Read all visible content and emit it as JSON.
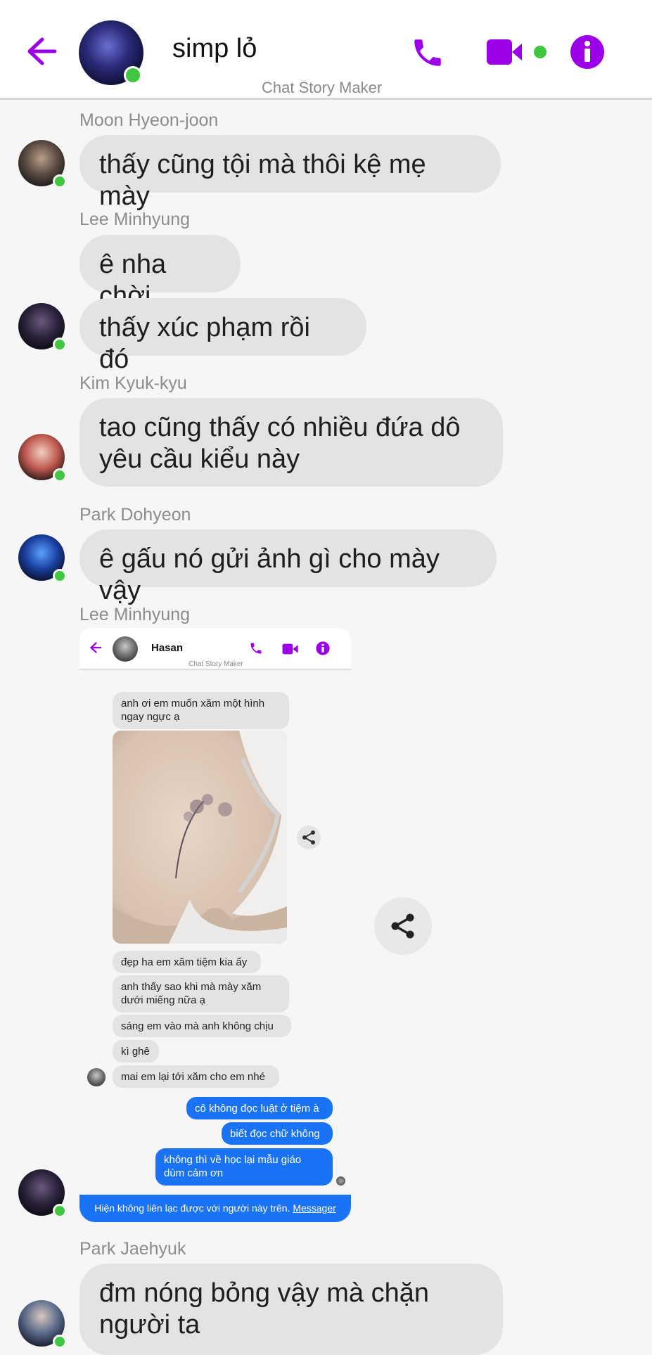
{
  "header": {
    "contact_name": "simp lỏ",
    "subtitle": "Chat Story Maker",
    "icons": [
      "back-arrow-icon",
      "phone-icon",
      "video-icon",
      "info-icon"
    ],
    "accent_color": "#9b00e8"
  },
  "messages": [
    {
      "sender": "Moon Hyeon-joon",
      "texts": [
        "thấy cũng tội mà thôi kệ mẹ mày"
      ]
    },
    {
      "sender": "Lee Minhyung",
      "texts": [
        "ê nha chời",
        "thấy xúc phạm rồi đó"
      ]
    },
    {
      "sender": "Kim Kyuk-kyu",
      "texts": [
        "tao cũng thấy có nhiều đứa dô\nyêu cầu kiểu này"
      ]
    },
    {
      "sender": "Park Dohyeon",
      "texts": [
        "ê gấu nó gửi ảnh gì cho mày vậy"
      ]
    },
    {
      "sender": "Lee Minhyung",
      "texts": []
    },
    {
      "sender": "Park Jaehyuk",
      "texts": [
        "đm nóng bỏng vậy mà chặn\nngười ta"
      ]
    }
  ],
  "shot": {
    "contact_name": "Hasan",
    "subtitle": "Chat Story Maker",
    "received": [
      "anh ơi em muốn xăm một hình ngay ngực ạ",
      "đẹp ha em xăm tiệm kia ấy",
      "anh thấy sao khi mà mày xăm dưới miếng nữa ạ",
      "sáng em vào mà anh không chịu",
      "kì ghê",
      "mai em lại tới xăm cho em nhé"
    ],
    "sent": [
      "cô không đọc luật ở tiệm à",
      "biết đọc chữ không",
      "không thì về học lại mẫu giáo dùm cảm ơn"
    ],
    "blocked_notice": "Hiện không liên lạc được với người này trên.",
    "blocked_link": "Messager"
  }
}
